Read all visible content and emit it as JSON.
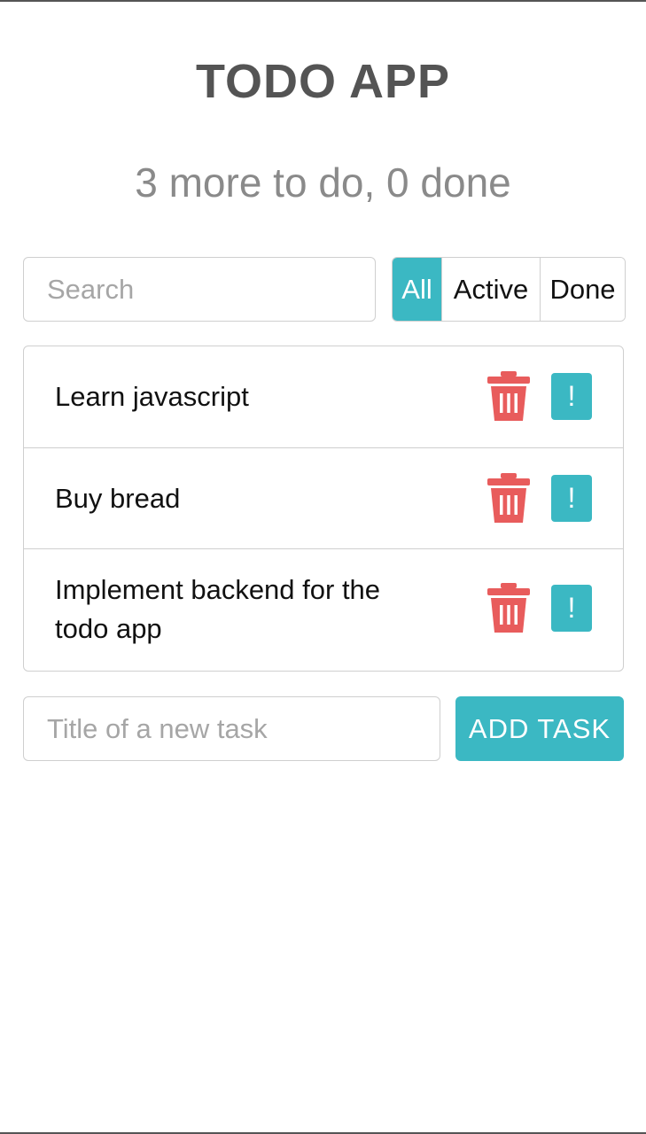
{
  "app": {
    "title": "TODO APP",
    "summary": "3 more to do, 0 done"
  },
  "search": {
    "placeholder": "Search",
    "value": ""
  },
  "filters": [
    {
      "label": "All",
      "active": true
    },
    {
      "label": "Active",
      "active": false
    },
    {
      "label": "Done",
      "active": false
    }
  ],
  "tasks": [
    {
      "label": "Learn javascript",
      "done": false,
      "important": false,
      "important_label": "!"
    },
    {
      "label": "Buy bread",
      "done": false,
      "important": false,
      "important_label": "!"
    },
    {
      "label": "Implement backend for the todo app",
      "done": false,
      "important": false,
      "important_label": "!"
    }
  ],
  "new_task": {
    "placeholder": "Title of a new task",
    "value": "",
    "add_label": "ADD TASK"
  },
  "icons": {
    "delete": "trash-icon",
    "important": "exclamation-icon"
  },
  "colors": {
    "accent": "#3bb8c3",
    "delete": "#e85c5c",
    "title": "#545454",
    "summary": "#8a8a8a"
  }
}
